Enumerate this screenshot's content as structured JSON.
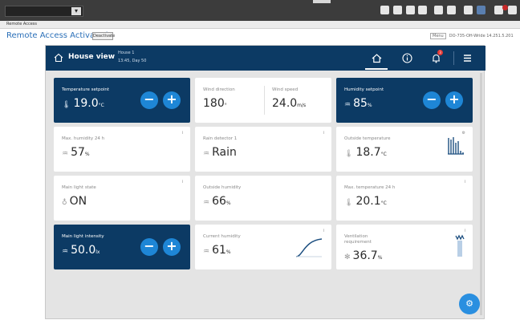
{
  "system_bar": {
    "sub_label": "Remote Access",
    "icons": [
      "grid-icon",
      "pin-icon",
      "grid-icon",
      "gear-icon",
      "user-icon",
      "edit-icon",
      "monitor-icon",
      "window-icon",
      "speaker-icon",
      "notification-icon",
      "settings-icon"
    ]
  },
  "remote_access": {
    "status": "Remote Access Activated",
    "deactivate_label": "Deactivate",
    "right_box": "Menu",
    "right_info": "DO-735-OH-Wride 14.251.5.201"
  },
  "header": {
    "title": "House view",
    "sub1": "House 1",
    "sub2": "13:45, Day 50",
    "badge": "3"
  },
  "tiles": {
    "temp_setpoint": {
      "label": "Temperature setpoint",
      "value": "19.0",
      "unit": "°C",
      "minus": "−",
      "plus": "+"
    },
    "wind_dir": {
      "label": "Wind direction",
      "value": "180",
      "unit": "°"
    },
    "wind_speed": {
      "label": "Wind speed",
      "value": "24.0",
      "unit": "m/s"
    },
    "hum_setpoint": {
      "label": "Humidity setpoint",
      "value": "85",
      "unit": "%",
      "minus": "−",
      "plus": "+"
    },
    "max_hum": {
      "label": "Max. humidity 24 h",
      "value": "57",
      "unit": "%"
    },
    "rain": {
      "label": "Rain detector 1",
      "value": "Rain"
    },
    "outside_temp": {
      "label": "Outside temperature",
      "value": "18.7",
      "unit": "°C"
    },
    "main_light": {
      "label": "Main light state",
      "value": "ON"
    },
    "outside_hum": {
      "label": "Outside humidity",
      "value": "66",
      "unit": "%"
    },
    "max_temp": {
      "label": "Max. temperature 24 h",
      "value": "20.1",
      "unit": "°C"
    },
    "light_int": {
      "label": "Main light intensity",
      "value": "50.0",
      "unit": "lx",
      "minus": "−",
      "plus": "+"
    },
    "cur_hum": {
      "label": "Current humidity",
      "value": "61",
      "unit": "%"
    },
    "vent": {
      "label": "Ventilation requirement",
      "value": "36.7",
      "unit": "%"
    }
  },
  "info_symbol": "i",
  "fab_icon": "⚙",
  "colors": {
    "header": "#0c3a64",
    "accent": "#1e86d6",
    "link": "#2a6fb8"
  }
}
